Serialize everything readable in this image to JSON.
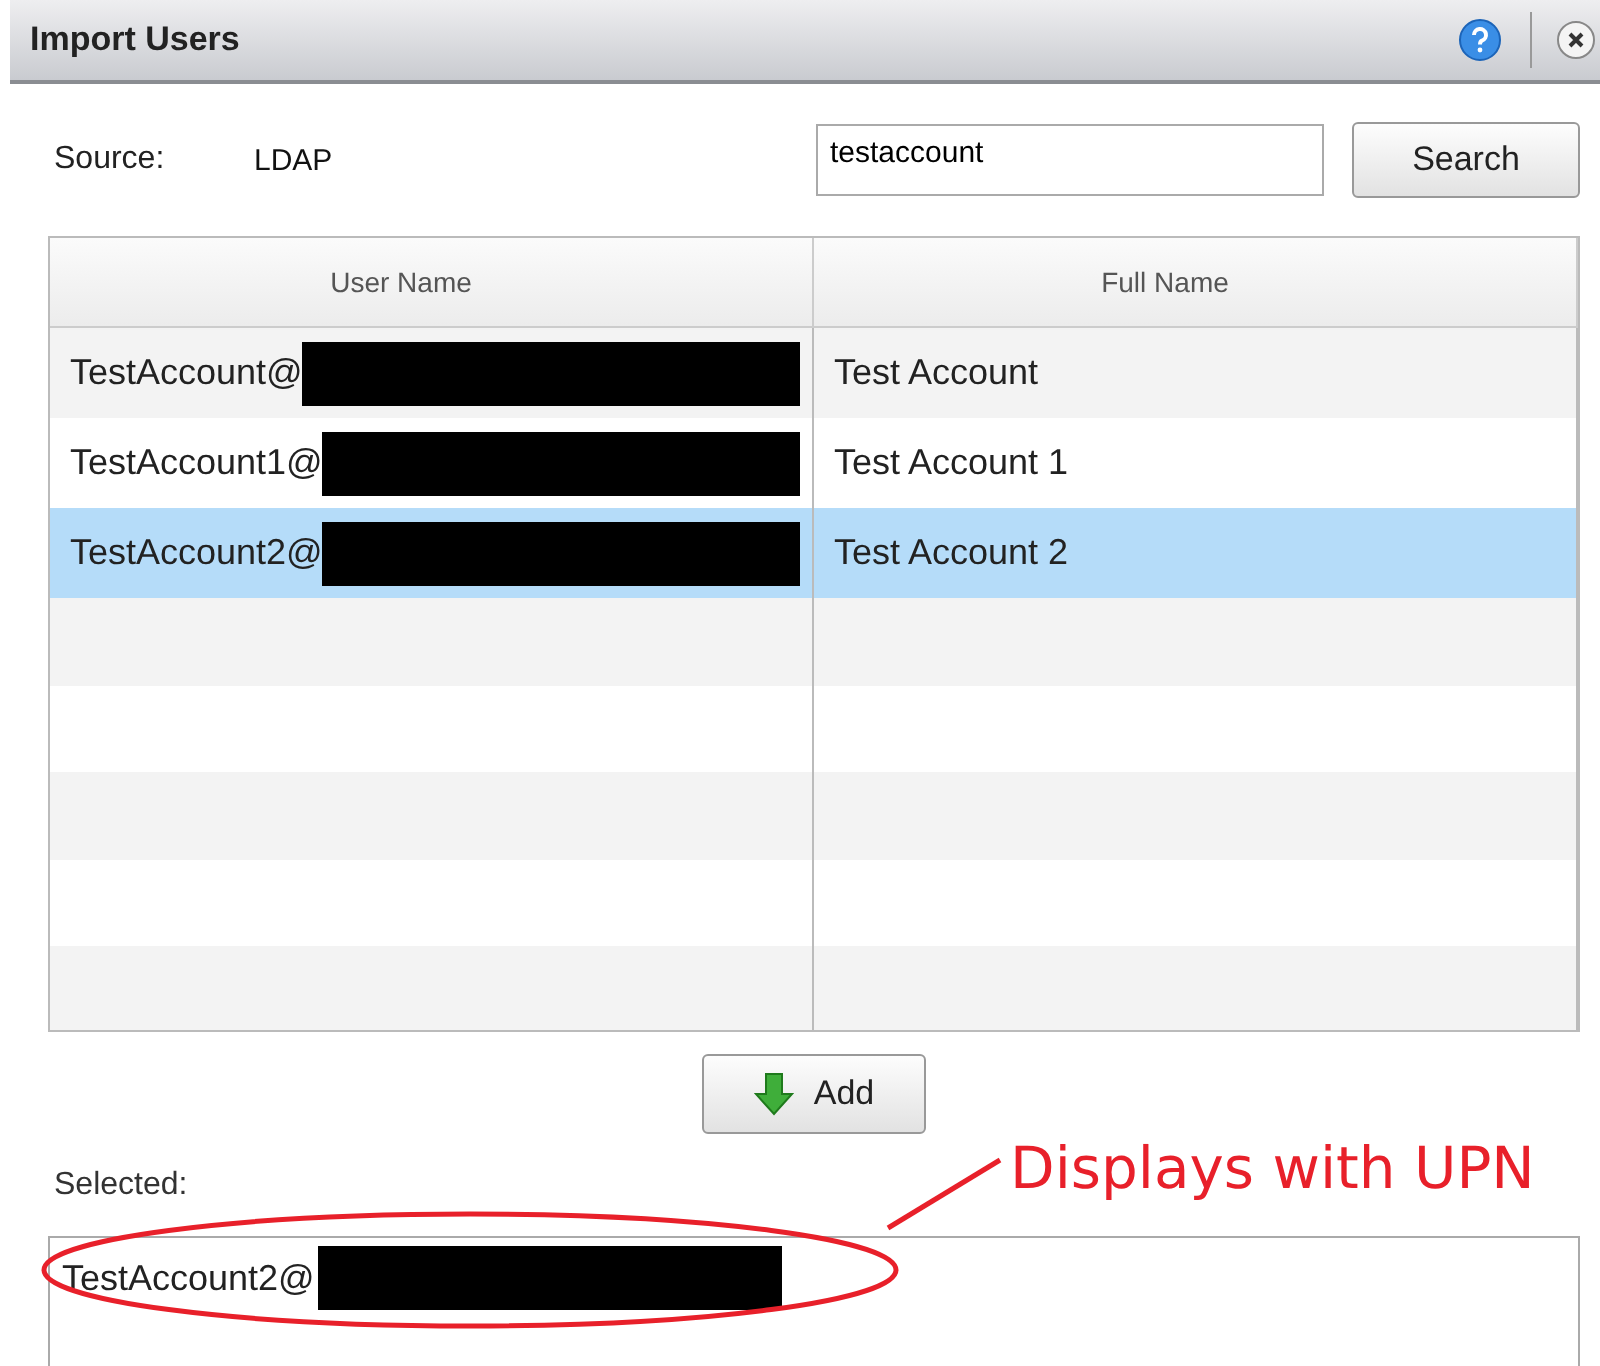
{
  "window": {
    "title": "Import Users"
  },
  "source": {
    "label": "Source:",
    "value": "LDAP"
  },
  "search": {
    "value": "testaccount",
    "button": "Search"
  },
  "table": {
    "columns": [
      "User Name",
      "Full Name"
    ],
    "rows": [
      {
        "user_name": "TestAccount@",
        "redacted": true,
        "full_name": "Test Account",
        "selected": false
      },
      {
        "user_name": "TestAccount1@",
        "redacted": true,
        "full_name": "Test Account 1",
        "selected": false
      },
      {
        "user_name": "TestAccount2@",
        "redacted": true,
        "full_name": "Test Account 2",
        "selected": true
      }
    ]
  },
  "add_button": "Add",
  "selected": {
    "label": "Selected:",
    "items": [
      {
        "text": "TestAccount2@",
        "redacted": true
      }
    ]
  },
  "annotation": {
    "text": "Displays with UPN"
  }
}
